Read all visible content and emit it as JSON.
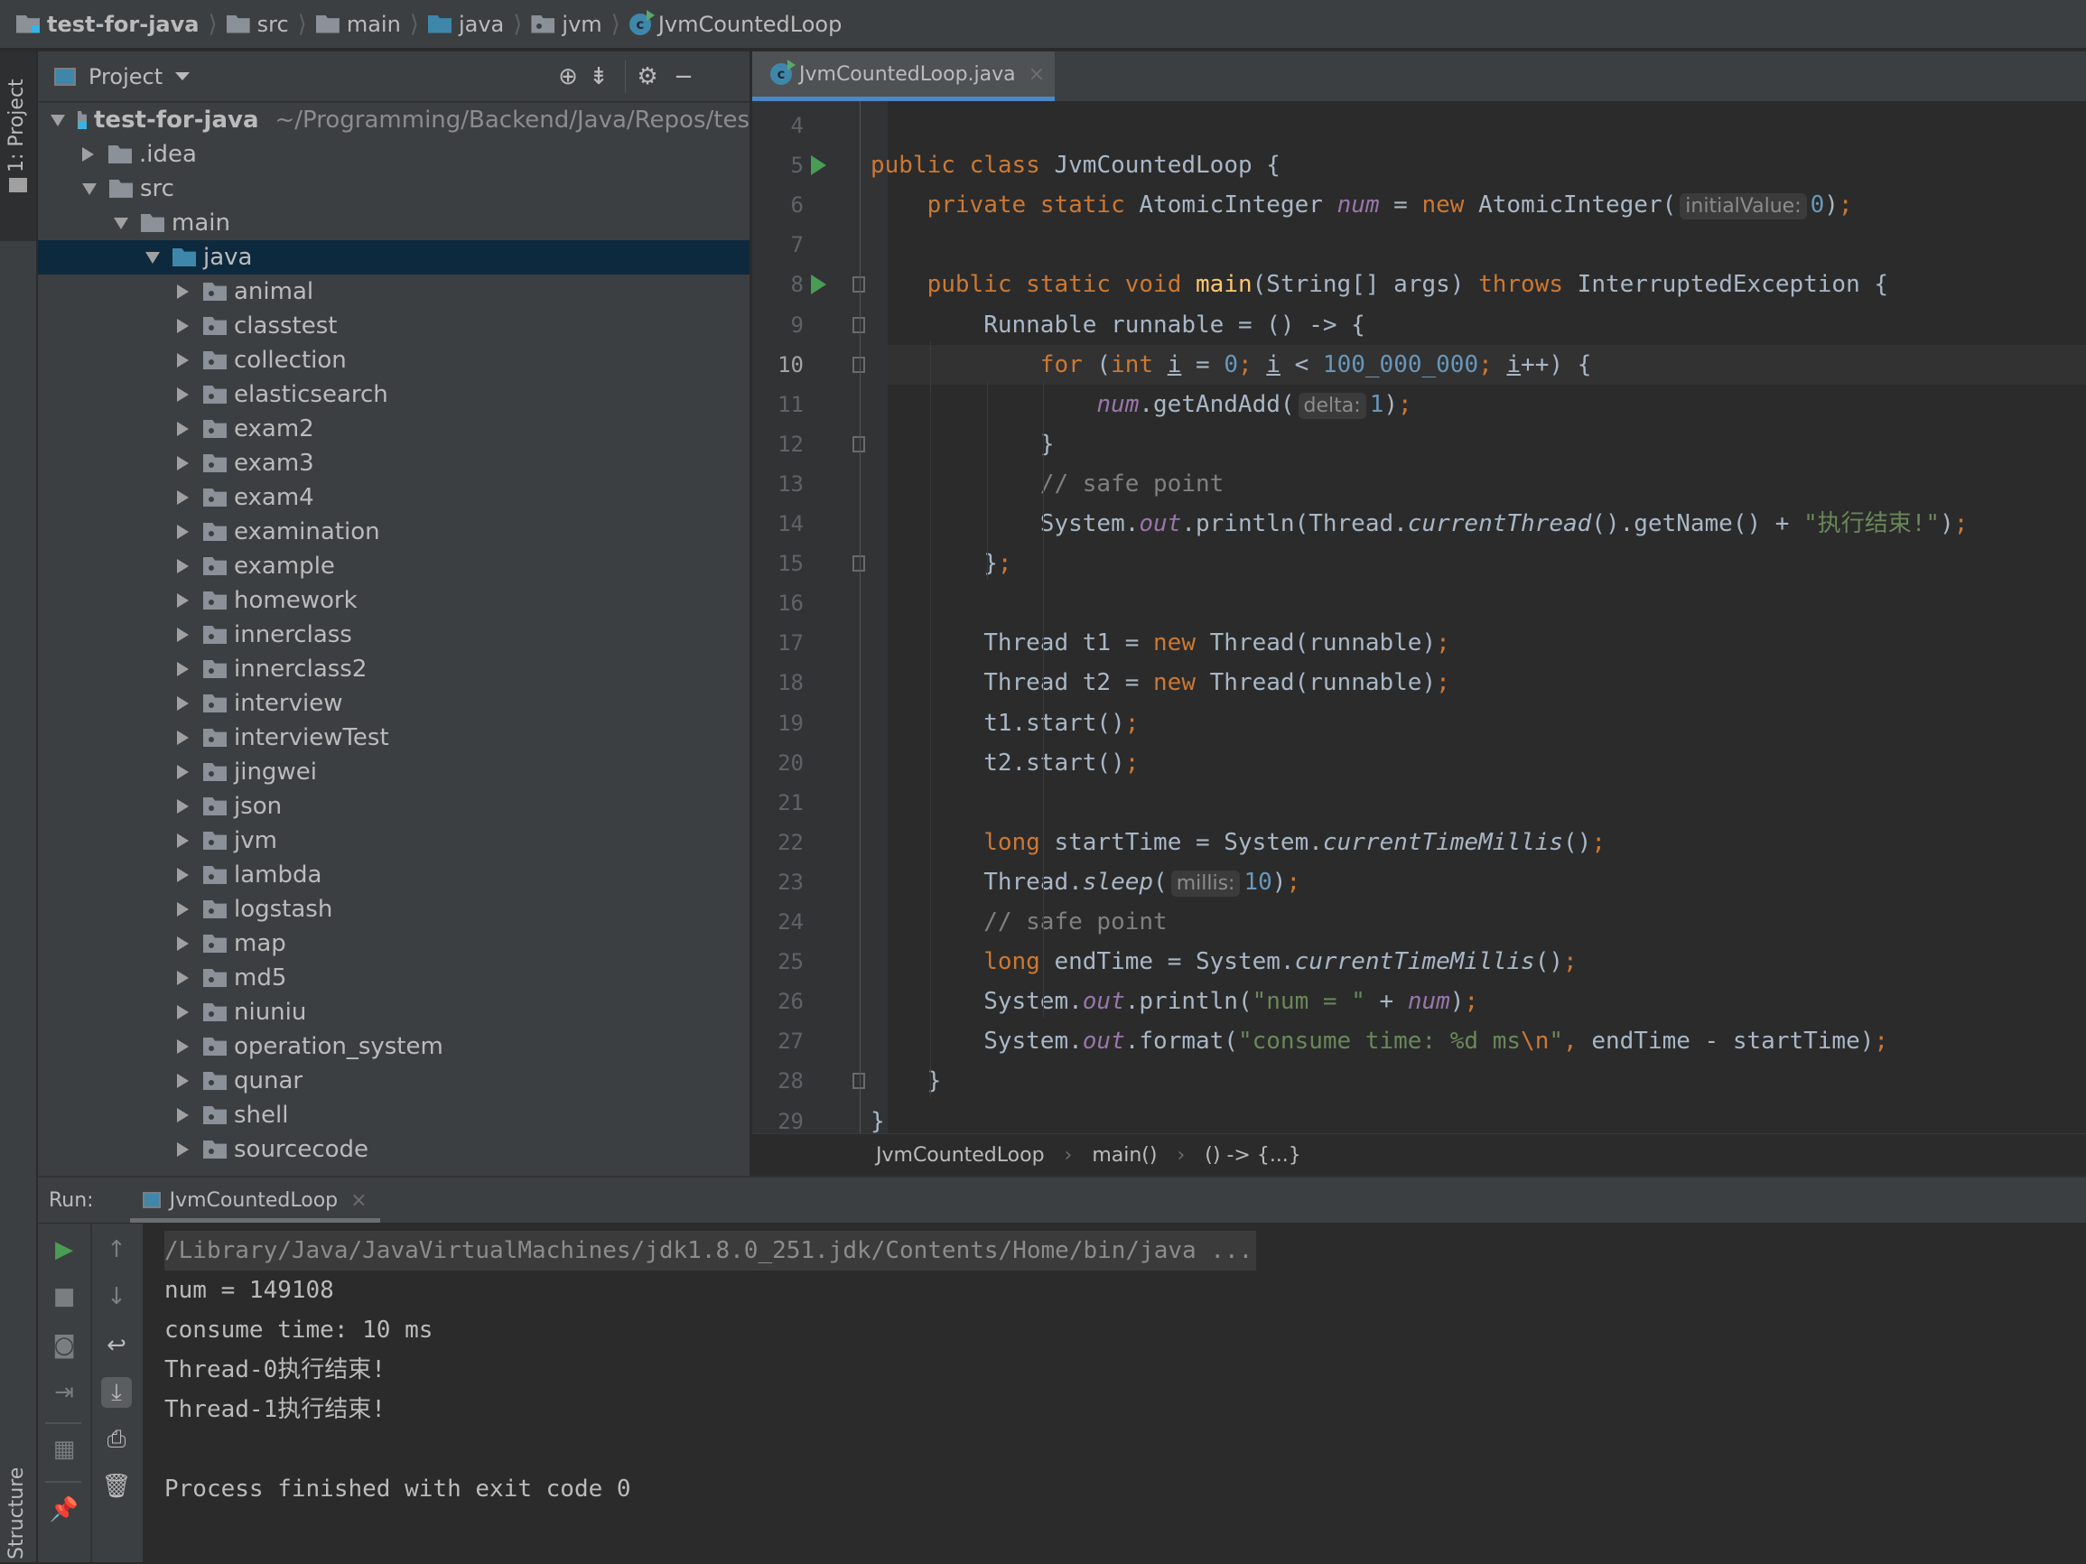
{
  "breadcrumb": [
    {
      "label": "test-for-java",
      "icon": "module-folder-icon"
    },
    {
      "label": "src",
      "icon": "folder-icon"
    },
    {
      "label": "main",
      "icon": "folder-icon"
    },
    {
      "label": "java",
      "icon": "source-folder-icon"
    },
    {
      "label": "jvm",
      "icon": "package-icon"
    },
    {
      "label": "JvmCountedLoop",
      "icon": "java-class-icon"
    }
  ],
  "left_strip": {
    "project_tab": "1: Project",
    "structure_tab": "Structure"
  },
  "project_panel": {
    "title": "Project",
    "tree": [
      {
        "label": "test-for-java",
        "hint": "~/Programming/Backend/Java/Repos/tes",
        "level": 0,
        "expanded": true,
        "icon": "module"
      },
      {
        "label": ".idea",
        "level": 1,
        "expanded": false,
        "icon": "folder"
      },
      {
        "label": "src",
        "level": 1,
        "expanded": true,
        "icon": "folder"
      },
      {
        "label": "main",
        "level": 2,
        "expanded": true,
        "icon": "folder"
      },
      {
        "label": "java",
        "level": 3,
        "expanded": true,
        "icon": "source",
        "selected": true
      },
      {
        "label": "animal",
        "level": 4,
        "expanded": false,
        "icon": "package"
      },
      {
        "label": "classtest",
        "level": 4,
        "expanded": false,
        "icon": "package"
      },
      {
        "label": "collection",
        "level": 4,
        "expanded": false,
        "icon": "package"
      },
      {
        "label": "elasticsearch",
        "level": 4,
        "expanded": false,
        "icon": "package"
      },
      {
        "label": "exam2",
        "level": 4,
        "expanded": false,
        "icon": "package"
      },
      {
        "label": "exam3",
        "level": 4,
        "expanded": false,
        "icon": "package"
      },
      {
        "label": "exam4",
        "level": 4,
        "expanded": false,
        "icon": "package"
      },
      {
        "label": "examination",
        "level": 4,
        "expanded": false,
        "icon": "package"
      },
      {
        "label": "example",
        "level": 4,
        "expanded": false,
        "icon": "package"
      },
      {
        "label": "homework",
        "level": 4,
        "expanded": false,
        "icon": "package"
      },
      {
        "label": "innerclass",
        "level": 4,
        "expanded": false,
        "icon": "package"
      },
      {
        "label": "innerclass2",
        "level": 4,
        "expanded": false,
        "icon": "package"
      },
      {
        "label": "interview",
        "level": 4,
        "expanded": false,
        "icon": "package"
      },
      {
        "label": "interviewTest",
        "level": 4,
        "expanded": false,
        "icon": "package"
      },
      {
        "label": "jingwei",
        "level": 4,
        "expanded": false,
        "icon": "package"
      },
      {
        "label": "json",
        "level": 4,
        "expanded": false,
        "icon": "package"
      },
      {
        "label": "jvm",
        "level": 4,
        "expanded": false,
        "icon": "package"
      },
      {
        "label": "lambda",
        "level": 4,
        "expanded": false,
        "icon": "package"
      },
      {
        "label": "logstash",
        "level": 4,
        "expanded": false,
        "icon": "package"
      },
      {
        "label": "map",
        "level": 4,
        "expanded": false,
        "icon": "package"
      },
      {
        "label": "md5",
        "level": 4,
        "expanded": false,
        "icon": "package"
      },
      {
        "label": "niuniu",
        "level": 4,
        "expanded": false,
        "icon": "package"
      },
      {
        "label": "operation_system",
        "level": 4,
        "expanded": false,
        "icon": "package"
      },
      {
        "label": "qunar",
        "level": 4,
        "expanded": false,
        "icon": "package"
      },
      {
        "label": "shell",
        "level": 4,
        "expanded": false,
        "icon": "package"
      },
      {
        "label": "sourcecode",
        "level": 4,
        "expanded": false,
        "icon": "package"
      }
    ]
  },
  "editor": {
    "tab": {
      "label": "JvmCountedLoop.java"
    },
    "current_line": 10,
    "lines": [
      {
        "n": 4,
        "indent": 0,
        "tokens": []
      },
      {
        "n": 5,
        "indent": 0,
        "run": true,
        "tokens": [
          [
            "kw",
            "public class "
          ],
          [
            "",
            "JvmCountedLoop {"
          ]
        ]
      },
      {
        "n": 6,
        "indent": 1,
        "tokens": [
          [
            "kw",
            "private static "
          ],
          [
            "",
            "AtomicInteger "
          ],
          [
            "fld",
            "num"
          ],
          [
            "",
            " = "
          ],
          [
            "kw",
            "new "
          ],
          [
            "",
            "AtomicInteger("
          ],
          [
            "hint",
            "initialValue:"
          ],
          [
            "num",
            "0"
          ],
          [
            "",
            ")"
          ],
          [
            "kw",
            ";"
          ]
        ]
      },
      {
        "n": 7,
        "indent": 0,
        "tokens": []
      },
      {
        "n": 8,
        "indent": 1,
        "run": true,
        "fold": true,
        "tokens": [
          [
            "kw",
            "public static void "
          ],
          [
            "fn",
            "main"
          ],
          [
            "",
            "(String[] args) "
          ],
          [
            "kw",
            "throws "
          ],
          [
            "",
            "InterruptedException {"
          ]
        ]
      },
      {
        "n": 9,
        "indent": 2,
        "fold": true,
        "tokens": [
          [
            "",
            "Runnable runnable = () -> {"
          ]
        ]
      },
      {
        "n": 10,
        "indent": 3,
        "fold": true,
        "tokens": [
          [
            "kw",
            "for "
          ],
          [
            "",
            "("
          ],
          [
            "kw",
            "int "
          ],
          [
            "ul",
            "i"
          ],
          [
            "",
            " = "
          ],
          [
            "num",
            "0"
          ],
          [
            "kw",
            "; "
          ],
          [
            "ul",
            "i"
          ],
          [
            "",
            " < "
          ],
          [
            "num",
            "100_000_000"
          ],
          [
            "kw",
            "; "
          ],
          [
            "ul",
            "i"
          ],
          [
            "",
            "++) {"
          ]
        ]
      },
      {
        "n": 11,
        "indent": 4,
        "tokens": [
          [
            "fld",
            "num"
          ],
          [
            "",
            ".getAndAdd("
          ],
          [
            "hint",
            "delta:"
          ],
          [
            "num",
            "1"
          ],
          [
            "",
            ")"
          ],
          [
            "kw",
            ";"
          ]
        ]
      },
      {
        "n": 12,
        "indent": 3,
        "fold": true,
        "tokens": [
          [
            "",
            "}"
          ]
        ]
      },
      {
        "n": 13,
        "indent": 3,
        "tokens": [
          [
            "cmt",
            "// safe point"
          ]
        ]
      },
      {
        "n": 14,
        "indent": 3,
        "tokens": [
          [
            "",
            "System."
          ],
          [
            "fld",
            "out"
          ],
          [
            "",
            ".println(Thread."
          ],
          [
            "it",
            "currentThread"
          ],
          [
            "",
            "().getName() + "
          ],
          [
            "str",
            "\"执行结束!\""
          ],
          [
            "",
            ")"
          ],
          [
            "kw",
            ";"
          ]
        ]
      },
      {
        "n": 15,
        "indent": 2,
        "fold": true,
        "tokens": [
          [
            "",
            "}"
          ],
          [
            "kw",
            ";"
          ]
        ]
      },
      {
        "n": 16,
        "indent": 0,
        "tokens": []
      },
      {
        "n": 17,
        "indent": 2,
        "tokens": [
          [
            "",
            "Thread t1 = "
          ],
          [
            "kw",
            "new "
          ],
          [
            "",
            "Thread(runnable)"
          ],
          [
            "kw",
            ";"
          ]
        ]
      },
      {
        "n": 18,
        "indent": 2,
        "tokens": [
          [
            "",
            "Thread t2 = "
          ],
          [
            "kw",
            "new "
          ],
          [
            "",
            "Thread(runnable)"
          ],
          [
            "kw",
            ";"
          ]
        ]
      },
      {
        "n": 19,
        "indent": 2,
        "tokens": [
          [
            "",
            "t1.start()"
          ],
          [
            "kw",
            ";"
          ]
        ]
      },
      {
        "n": 20,
        "indent": 2,
        "tokens": [
          [
            "",
            "t2.start()"
          ],
          [
            "kw",
            ";"
          ]
        ]
      },
      {
        "n": 21,
        "indent": 0,
        "tokens": []
      },
      {
        "n": 22,
        "indent": 2,
        "tokens": [
          [
            "kw",
            "long "
          ],
          [
            "",
            "startTime = System."
          ],
          [
            "it",
            "currentTimeMillis"
          ],
          [
            "",
            "()"
          ],
          [
            "kw",
            ";"
          ]
        ]
      },
      {
        "n": 23,
        "indent": 2,
        "tokens": [
          [
            "",
            "Thread."
          ],
          [
            "it",
            "sleep"
          ],
          [
            "",
            "("
          ],
          [
            "hint",
            "millis:"
          ],
          [
            "num",
            "10"
          ],
          [
            "",
            ")"
          ],
          [
            "kw",
            ";"
          ]
        ]
      },
      {
        "n": 24,
        "indent": 2,
        "tokens": [
          [
            "cmt",
            "// safe point"
          ]
        ]
      },
      {
        "n": 25,
        "indent": 2,
        "tokens": [
          [
            "kw",
            "long "
          ],
          [
            "",
            "endTime = System."
          ],
          [
            "it",
            "currentTimeMillis"
          ],
          [
            "",
            "()"
          ],
          [
            "kw",
            ";"
          ]
        ]
      },
      {
        "n": 26,
        "indent": 2,
        "tokens": [
          [
            "",
            "System."
          ],
          [
            "fld",
            "out"
          ],
          [
            "",
            ".println("
          ],
          [
            "str",
            "\"num = \""
          ],
          [
            "",
            " + "
          ],
          [
            "fld",
            "num"
          ],
          [
            "",
            ")"
          ],
          [
            "kw",
            ";"
          ]
        ]
      },
      {
        "n": 27,
        "indent": 2,
        "tokens": [
          [
            "",
            "System."
          ],
          [
            "fld",
            "out"
          ],
          [
            "",
            ".format("
          ],
          [
            "str",
            "\"consume time: %d ms"
          ],
          [
            "kw",
            "\\n"
          ],
          [
            "str",
            "\""
          ],
          [
            "kw",
            ", "
          ],
          [
            "",
            "endTime - startTime)"
          ],
          [
            "kw",
            ";"
          ]
        ]
      },
      {
        "n": 28,
        "indent": 1,
        "fold": true,
        "tokens": [
          [
            "",
            "}"
          ]
        ]
      },
      {
        "n": 29,
        "indent": 0,
        "tokens": [
          [
            "",
            "}"
          ]
        ]
      }
    ],
    "breadcrumbs": [
      "JvmCountedLoop",
      "main()",
      "() -> {...}"
    ]
  },
  "run_panel": {
    "label": "Run:",
    "tab": "JvmCountedLoop",
    "console": [
      {
        "text": "/Library/Java/JavaVirtualMachines/jdk1.8.0_251.jdk/Contents/Home/bin/java ...",
        "kind": "cmd"
      },
      {
        "text": "num = 149108",
        "kind": "out"
      },
      {
        "text": "consume time: 10 ms",
        "kind": "out"
      },
      {
        "text": "Thread-0执行结束!",
        "kind": "out"
      },
      {
        "text": "Thread-1执行结束!",
        "kind": "out"
      },
      {
        "text": "",
        "kind": "out"
      },
      {
        "text": "Process finished with exit code 0",
        "kind": "out"
      }
    ]
  }
}
